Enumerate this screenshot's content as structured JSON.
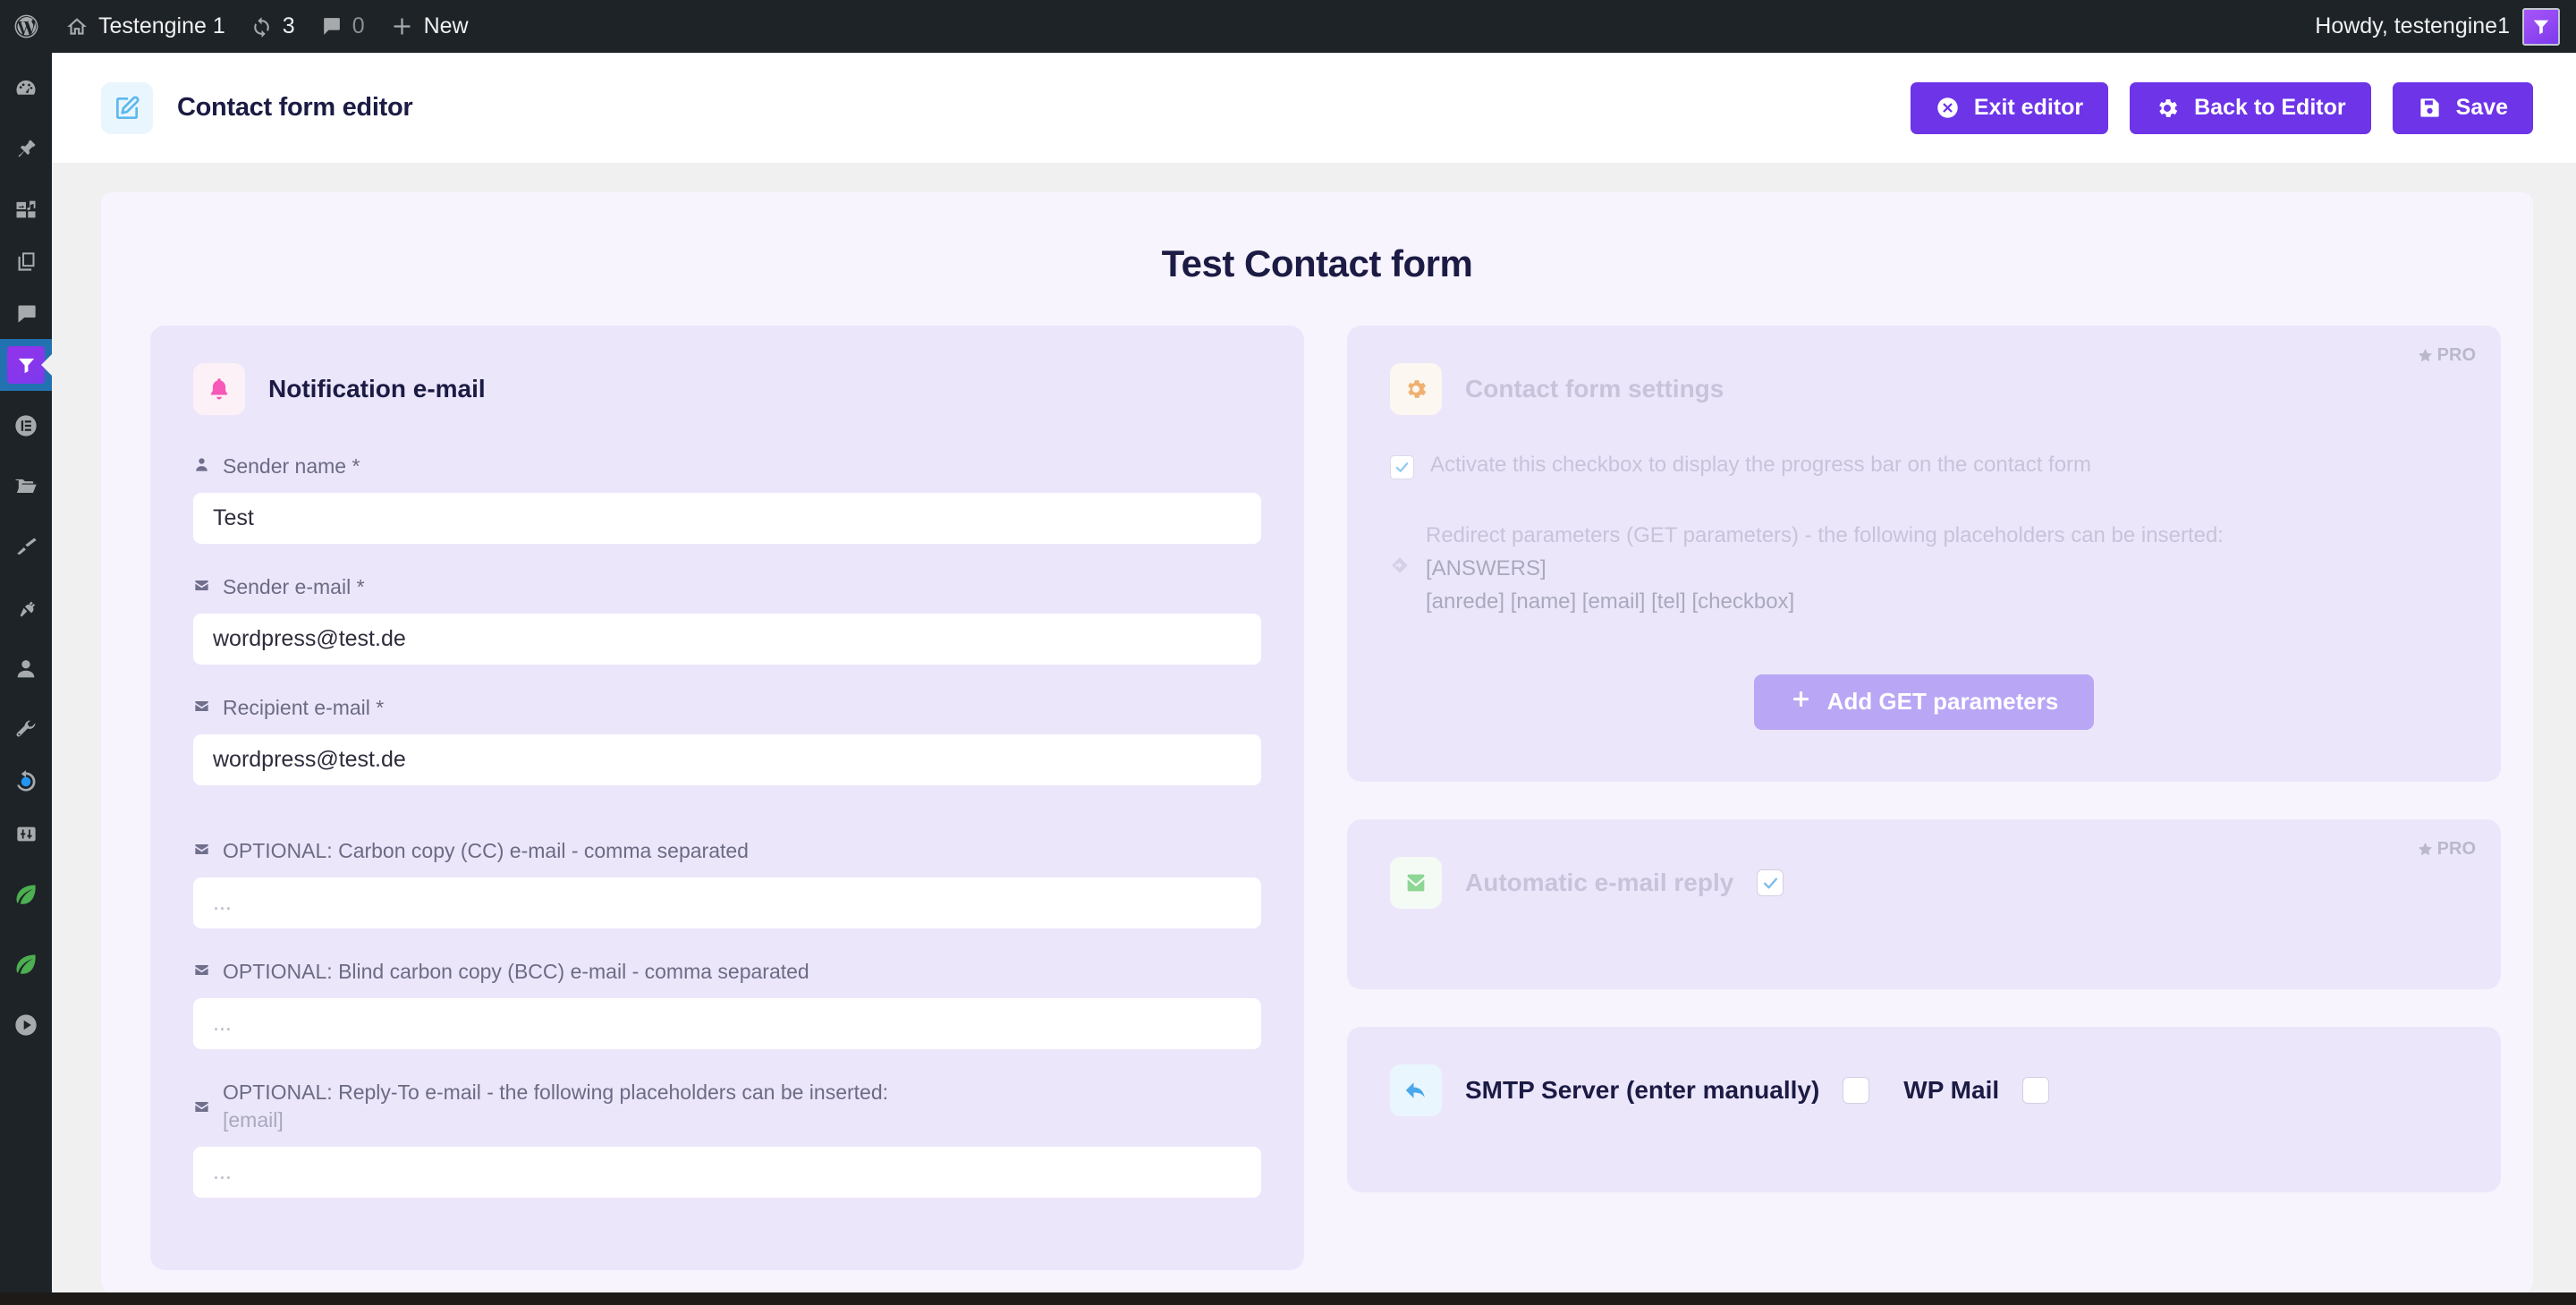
{
  "adminbar": {
    "wp_logo_icon": "wordpress-logo-icon",
    "site_icon": "home-icon",
    "site_name": "Testengine 1",
    "updates_icon": "updates-icon",
    "updates_count": "3",
    "comments_icon": "comment-icon",
    "comments_count": "0",
    "new_icon": "plus-icon",
    "new_label": "New",
    "howdy": "Howdy, testengine1",
    "avatar_icon": "funnel-avatar-icon"
  },
  "sidebar": {
    "items": [
      {
        "name": "dashboard",
        "icon": "dashboard-icon",
        "active": false
      },
      {
        "name": "posts",
        "icon": "pin-icon",
        "active": false
      },
      {
        "name": "media",
        "icon": "media-icon",
        "active": false
      },
      {
        "name": "pages",
        "icon": "pages-icon",
        "active": false
      },
      {
        "name": "comments",
        "icon": "comment-icon",
        "active": false
      },
      {
        "name": "funnel-plugin",
        "icon": "funnel-icon",
        "active": true
      },
      {
        "name": "elementor",
        "icon": "elementor-icon",
        "active": false
      },
      {
        "name": "folders",
        "icon": "folder-icon",
        "active": false
      },
      {
        "name": "appearance",
        "icon": "brush-icon",
        "active": false
      },
      {
        "name": "plugins",
        "icon": "plug-icon",
        "active": false
      },
      {
        "name": "users",
        "icon": "user-icon",
        "active": false
      },
      {
        "name": "tools",
        "icon": "wrench-icon",
        "active": false
      },
      {
        "name": "updates",
        "icon": "refresh-icon",
        "active": false
      },
      {
        "name": "settings",
        "icon": "sliders-icon",
        "active": false
      },
      {
        "name": "leaf-plugin-1",
        "icon": "leaf-icon",
        "active": false
      },
      {
        "name": "leaf-plugin-2",
        "icon": "leaf-icon",
        "active": false
      },
      {
        "name": "media-player-plugin",
        "icon": "play-circle-icon",
        "active": false
      }
    ]
  },
  "header": {
    "icon": "edit-pencil-icon",
    "title": "Contact form editor",
    "buttons": [
      {
        "label": "Exit editor",
        "icon": "close-circle-icon"
      },
      {
        "label": "Back to Editor",
        "icon": "gear-icon"
      },
      {
        "label": "Save",
        "icon": "save-disk-icon"
      }
    ],
    "accent_color": "#6d34e8"
  },
  "canvas": {
    "form_title": "Test Contact form"
  },
  "notification": {
    "icon": "bell-icon",
    "title": "Notification e-mail",
    "fields": [
      {
        "label": "Sender name *",
        "icon": "person-icon",
        "value": "Test",
        "placeholder": "",
        "hint": ""
      },
      {
        "label": "Sender e-mail *",
        "icon": "envelope-icon",
        "value": "wordpress@test.de",
        "placeholder": "",
        "hint": ""
      },
      {
        "label": "Recipient e-mail *",
        "icon": "envelope-icon",
        "value": "wordpress@test.de",
        "placeholder": "",
        "hint": ""
      },
      {
        "label": "OPTIONAL: Carbon copy (CC) e-mail - comma separated",
        "icon": "envelope-icon",
        "value": "",
        "placeholder": "...",
        "hint": ""
      },
      {
        "label": "OPTIONAL: Blind carbon copy (BCC) e-mail - comma separated",
        "icon": "envelope-icon",
        "value": "",
        "placeholder": "...",
        "hint": ""
      },
      {
        "label": "OPTIONAL: Reply-To e-mail - the following placeholders can be inserted:",
        "icon": "envelope-icon",
        "value": "",
        "placeholder": "...",
        "hint": "[email]"
      }
    ]
  },
  "settings": {
    "pro_label": "PRO",
    "icon": "gear-icon",
    "title": "Contact form settings",
    "progressbar_checkbox_label": "Activate this checkbox to display the progress bar on the contact form",
    "progressbar_checked": true,
    "redirect_icon": "diamond-arrow-icon",
    "redirect_label": "Redirect parameters (GET parameters) - the following placeholders can be inserted:",
    "redirect_placeholder_1": "[ANSWERS]",
    "redirect_placeholder_2": "[anrede] [name] [email] [tel] [checkbox]",
    "add_get_label": "Add GET parameters",
    "add_get_icon": "plus-icon"
  },
  "auto_reply": {
    "pro_label": "PRO",
    "icon": "envelope-green-icon",
    "title": "Automatic e-mail reply",
    "checked": true
  },
  "smtp": {
    "icon": "reply-arrow-icon",
    "title": "SMTP Server (enter manually)",
    "smtp_checked": false,
    "wpmail_label": "WP Mail",
    "wpmail_checked": false
  }
}
